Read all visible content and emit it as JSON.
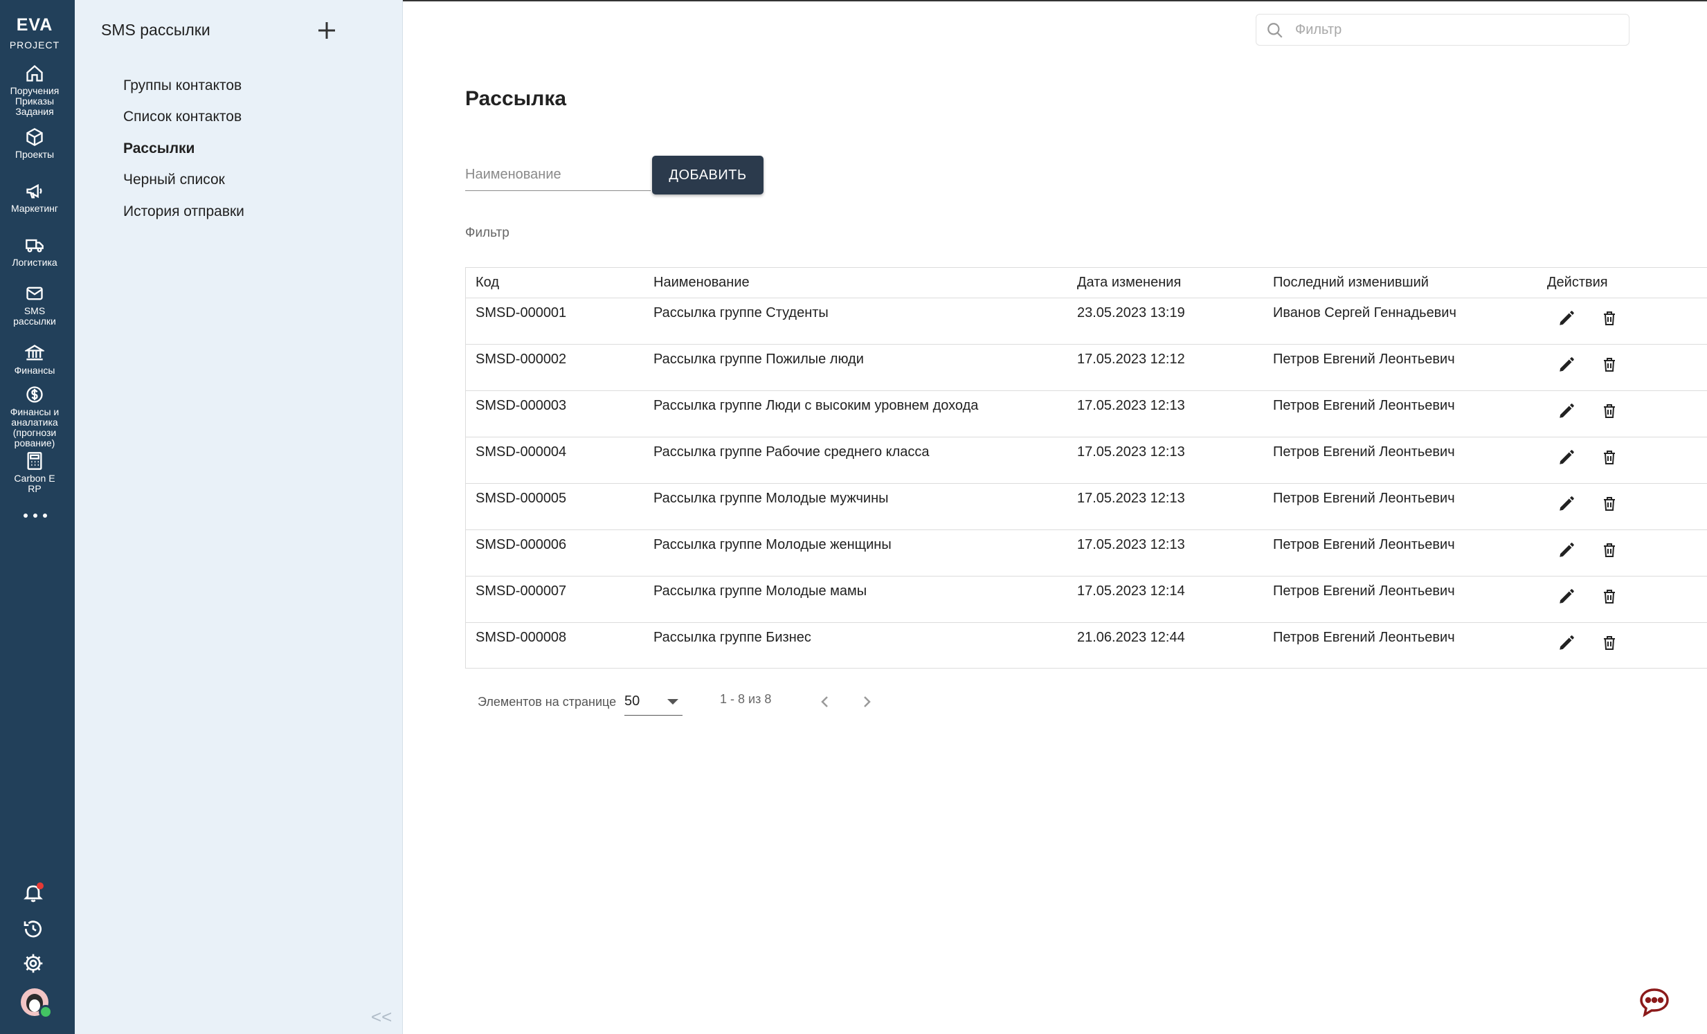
{
  "brand": {
    "line1": "EVA",
    "line2": "PROJECT"
  },
  "rail": {
    "items": [
      {
        "label": "Поручения\nПриказы\nЗадания",
        "icon": "home-icon"
      },
      {
        "label": "Проекты",
        "icon": "cube-icon"
      },
      {
        "label": "Маркетинг",
        "icon": "megaphone-icon"
      },
      {
        "label": "Логистика",
        "icon": "truck-icon"
      },
      {
        "label": "SMS\nрассылки",
        "icon": "mail-icon"
      },
      {
        "label": "Финансы",
        "icon": "bank-icon"
      },
      {
        "label": "Финансы и\nаналатика\n(прогнози\nрование)",
        "icon": "dollar-icon"
      },
      {
        "label": "Carbon E\nRP",
        "icon": "calculator-icon"
      }
    ]
  },
  "sidebar": {
    "title": "SMS рассылки",
    "links": [
      {
        "label": "Группы контактов",
        "active": false
      },
      {
        "label": "Список контактов",
        "active": false
      },
      {
        "label": "Рассылки",
        "active": true
      },
      {
        "label": "Черный список",
        "active": false
      },
      {
        "label": "История отправки",
        "active": false
      }
    ],
    "collapse": "<<"
  },
  "search": {
    "placeholder": "Фильтр",
    "value": ""
  },
  "page": {
    "title": "Рассылка",
    "name_placeholder": "Наименование",
    "add_label": "ДОБАВИТЬ",
    "filter_label": "Фильтр"
  },
  "table": {
    "columns": [
      "Код",
      "Наименование",
      "Дата изменения",
      "Последний изменивший",
      "Действия"
    ],
    "rows": [
      [
        "SMSD-000001",
        "Рассылка группе Студенты",
        "23.05.2023 13:19",
        "Иванов Сергей Геннадьевич"
      ],
      [
        "SMSD-000002",
        "Рассылка группе Пожилые люди",
        "17.05.2023 12:12",
        "Петров Евгений Леонтьевич"
      ],
      [
        "SMSD-000003",
        "Рассылка группе Люди с высоким уровнем дохода",
        "17.05.2023 12:13",
        "Петров Евгений Леонтьевич"
      ],
      [
        "SMSD-000004",
        "Рассылка группе Рабочие среднего класса",
        "17.05.2023 12:13",
        "Петров Евгений Леонтьевич"
      ],
      [
        "SMSD-000005",
        "Рассылка группе Молодые мужчины",
        "17.05.2023 12:13",
        "Петров Евгений Леонтьевич"
      ],
      [
        "SMSD-000006",
        "Рассылка группе Молодые женщины",
        "17.05.2023 12:13",
        "Петров Евгений Леонтьевич"
      ],
      [
        "SMSD-000007",
        "Рассылка группе Молодые мамы",
        "17.05.2023 12:14",
        "Петров Евгений Леонтьевич"
      ],
      [
        "SMSD-000008",
        "Рассылка группе Бизнес",
        "21.06.2023 12:44",
        "Петров Евгений Леонтьевич"
      ]
    ]
  },
  "pager": {
    "label": "Элементов на странице",
    "page_size": "50",
    "range": "1 - 8 из 8"
  },
  "colors": {
    "rail": "#22405a",
    "sidebar": "#e9f1f8",
    "button": "#2b3a4c",
    "chat": "#8b1a1a",
    "notification": "#e53935",
    "online": "#43c463"
  }
}
